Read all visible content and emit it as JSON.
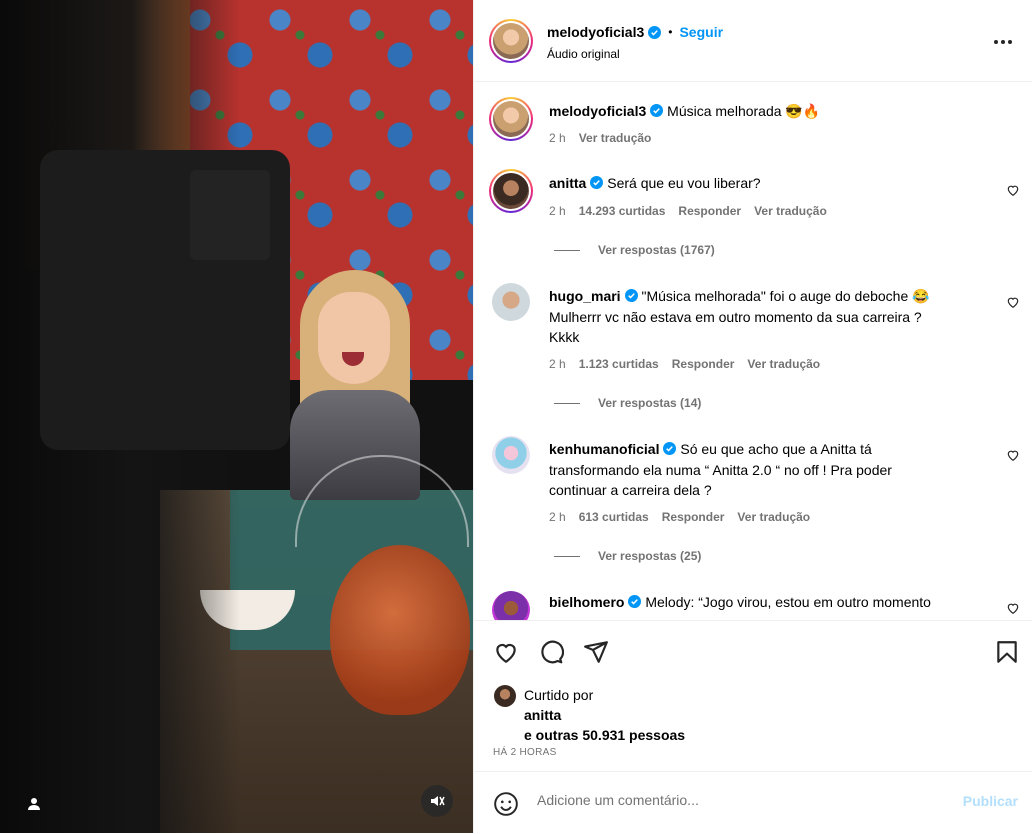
{
  "colors": {
    "accent": "#0095f6",
    "muted": "#737373",
    "border": "#efefef",
    "publish_disabled": "#b2dffc"
  },
  "post": {
    "author": "melodyoficial3",
    "follow_label": "Seguir",
    "separator": "•",
    "audio": "Áudio original",
    "caption_user": "melodyoficial3",
    "caption_text": "Música melhorada 😎🔥",
    "caption_time": "2 h",
    "caption_translate": "Ver tradução"
  },
  "comments": [
    {
      "user": "anitta",
      "verified": true,
      "lines": [
        "Será que eu vou liberar?"
      ],
      "time": "2 h",
      "likes": "14.293 curtidas",
      "reply": "Responder",
      "translate": "Ver tradução",
      "view_replies": "Ver respostas (1767)"
    },
    {
      "user": "hugo_mari",
      "verified": true,
      "lines": [
        "\"Música melhorada\" foi o auge do deboche 😂",
        "Mulherrr vc não estava em outro momento da sua carreira ?",
        "Kkkk"
      ],
      "time": "2 h",
      "likes": "1.123 curtidas",
      "reply": "Responder",
      "translate": "Ver tradução",
      "view_replies": "Ver respostas (14)"
    },
    {
      "user": "kenhumanoficial",
      "verified": true,
      "lines": [
        "Só eu que acho que a Anitta tá",
        "transformando ela numa “ Anitta 2.0 “ no off ! Pra poder",
        "continuar a carreira dela ?"
      ],
      "time": "2 h",
      "likes": "613 curtidas",
      "reply": "Responder",
      "translate": "Ver tradução",
      "view_replies": "Ver respostas (25)"
    },
    {
      "user": "bielhomero",
      "verified": true,
      "lines": [
        "Melody: “Jogo virou, estou em outro momento"
      ]
    }
  ],
  "likes": {
    "liked_by_label": "Curtido por",
    "liked_by_user": "anitta",
    "others": "e outras 50.931 pessoas",
    "time_ago": "HÁ 2 HORAS"
  },
  "add_comment": {
    "placeholder": "Adicione um comentário...",
    "publish": "Publicar"
  },
  "icons": [
    "like-heart-icon",
    "comment-icon",
    "share-icon",
    "save-bookmark-icon",
    "emoji-icon",
    "more-options-icon",
    "verified-icon",
    "mute-icon",
    "tag-user-icon"
  ]
}
